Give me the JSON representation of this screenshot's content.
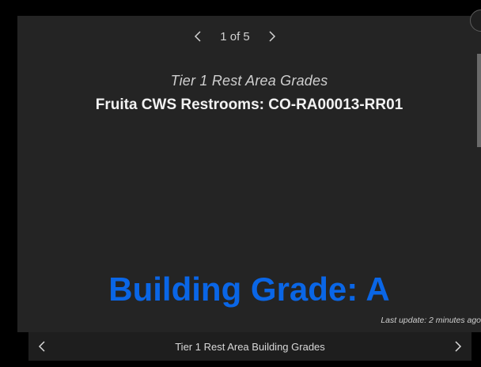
{
  "pager": {
    "count_label": "1 of 5"
  },
  "popup": {
    "subtitle": "Tier 1 Rest Area Grades",
    "title": "Fruita CWS Restrooms: CO-RA00013-RR01",
    "grade_text": "Building Grade: A",
    "last_update": "Last update: 2 minutes ago"
  },
  "footer": {
    "title": "Tier 1 Rest Area Building Grades"
  },
  "colors": {
    "background": "#000000",
    "panel": "#242424",
    "footer": "#1e1e1e",
    "grade_accent": "#0a66e6",
    "text": "#f2f2f2"
  },
  "icons": {
    "pager_prev": "chevron-left-icon",
    "pager_next": "chevron-right-icon",
    "footer_prev": "chevron-left-icon",
    "footer_next": "chevron-right-icon",
    "close": "close-icon"
  }
}
